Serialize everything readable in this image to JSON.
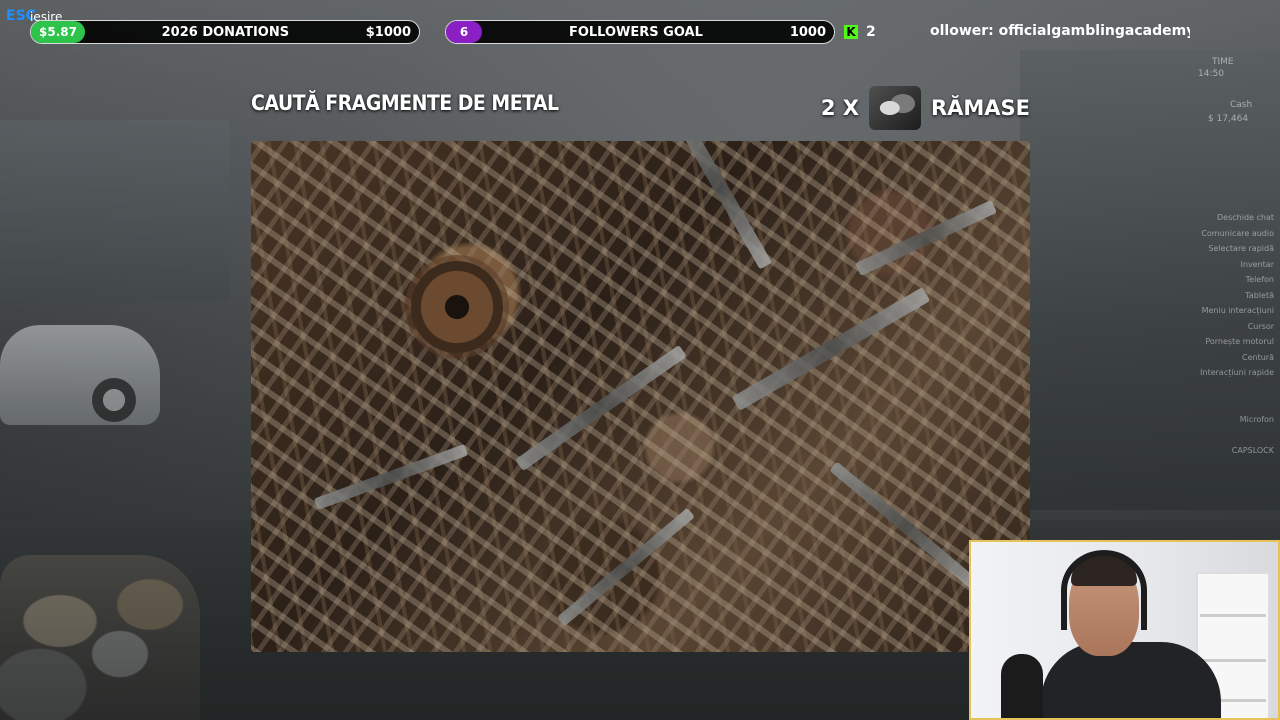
{
  "top_bar": {
    "esc_key": "ESC",
    "esc_label": "iesire",
    "donations": {
      "amount": "$5.87",
      "label": "2026 DONATIONS",
      "goal": "$1000",
      "progress": 0.006
    },
    "followers": {
      "count": "6",
      "label": "FOLLOWERS GOAL",
      "goal": "1000",
      "progress": 0.006
    },
    "kick": {
      "icon": "kick-icon",
      "value": "2",
      "color": "#53fc18"
    },
    "latest_follower": "ollower: officialgamblingacademy"
  },
  "minigame": {
    "title": "CAUTĂ FRAGMENTE DE METAL",
    "remaining_prefix": "2 X",
    "remaining_suffix": "RĂMASE",
    "item_icon": "scrap-metal-icon"
  },
  "hud": {
    "time_label": "TIME",
    "time_value": "14:50",
    "cash_label": "Cash",
    "cash_value": "$ 17,464",
    "menu_items": [
      "Deschide chat",
      "Comunicare audio",
      "Selectare rapidă",
      "Inventar",
      "Telefon",
      "Tabletă",
      "Meniu interacțiuni",
      "Cursor",
      "Pornește motorul",
      "Centură",
      "Interacțiuni rapide",
      "",
      "",
      "Microfon",
      "",
      "CAPSLOCK"
    ]
  },
  "colors": {
    "donation_badge": "#2ec34a",
    "followers_badge": "#8a1fc4",
    "esc_blue": "#1f8fff",
    "webcam_border": "#e6c25a"
  }
}
